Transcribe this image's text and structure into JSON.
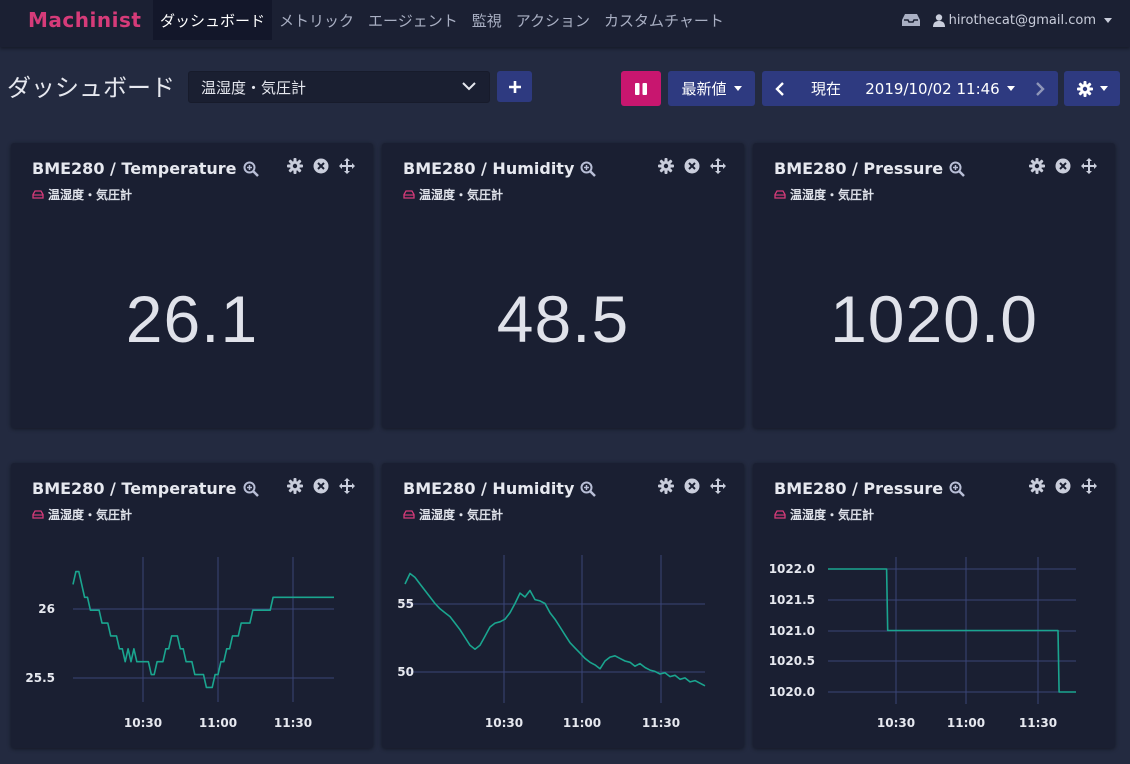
{
  "nav": {
    "brand": "Machinist",
    "items": [
      {
        "label": "ダッシュボード",
        "active": true
      },
      {
        "label": "メトリック"
      },
      {
        "label": "エージェント"
      },
      {
        "label": "監視"
      },
      {
        "label": "アクション"
      },
      {
        "label": "カスタムチャート"
      }
    ],
    "user_email": "hirothecat@gmail.com"
  },
  "toolbar": {
    "title": "ダッシュボード",
    "dashboard_select": "温湿度・気圧計",
    "latest_label": "最新値",
    "now_label": "現在",
    "datetime": "2019/10/02 11:46"
  },
  "colors": {
    "accent": "#c8166f",
    "brand": "#d63b79",
    "button": "#2e3a80",
    "line": "#1aa58f"
  },
  "value_cards": [
    {
      "title": "BME280 / Temperature",
      "agent": "温湿度・気圧計",
      "value": "26.1"
    },
    {
      "title": "BME280 / Humidity",
      "agent": "温湿度・気圧計",
      "value": "48.5"
    },
    {
      "title": "BME280 / Pressure",
      "agent": "温湿度・気圧計",
      "value": "1020.0"
    }
  ],
  "chart_data": [
    {
      "type": "line",
      "title": "BME280 / Temperature",
      "x_ticks": [
        "10:30",
        "11:00",
        "11:30"
      ],
      "y_ticks": [
        "26",
        "25.5"
      ],
      "ylim": [
        25.38,
        26.32
      ],
      "x": [
        0,
        1,
        2,
        3,
        4,
        5,
        6,
        7,
        8,
        9,
        10,
        11,
        12,
        13,
        14,
        15,
        16,
        17,
        18,
        19,
        20,
        21,
        22,
        23,
        24,
        25,
        26,
        27,
        28,
        29,
        30,
        31,
        32,
        33,
        34,
        35,
        36,
        37,
        38,
        39,
        40,
        41,
        42,
        43,
        44,
        45,
        46,
        47,
        48,
        49,
        50,
        51,
        52,
        53,
        54,
        55,
        56,
        57,
        58,
        59,
        60,
        61,
        62,
        63,
        64,
        65,
        66,
        67,
        68,
        69,
        70,
        71,
        72,
        73,
        74,
        75,
        76,
        77,
        78,
        79,
        80,
        81,
        82,
        83,
        84,
        85,
        86,
        87,
        88,
        89,
        90
      ],
      "values": [
        26.2,
        26.3,
        26.3,
        26.2,
        26.1,
        26.1,
        26.0,
        26.0,
        26.0,
        26.0,
        25.9,
        25.9,
        25.9,
        25.8,
        25.8,
        25.8,
        25.7,
        25.7,
        25.6,
        25.7,
        25.6,
        25.7,
        25.6,
        25.6,
        25.6,
        25.6,
        25.6,
        25.5,
        25.5,
        25.6,
        25.6,
        25.6,
        25.7,
        25.7,
        25.8,
        25.8,
        25.8,
        25.7,
        25.7,
        25.6,
        25.6,
        25.6,
        25.5,
        25.5,
        25.5,
        25.5,
        25.4,
        25.4,
        25.4,
        25.5,
        25.5,
        25.6,
        25.6,
        25.7,
        25.7,
        25.8,
        25.8,
        25.8,
        25.9,
        25.9,
        25.9,
        25.9,
        26.0,
        26.0,
        26.0,
        26.0,
        26.0,
        26.0,
        26.0,
        26.1,
        26.1,
        26.1,
        26.1,
        26.1,
        26.1,
        26.1,
        26.1,
        26.1,
        26.1,
        26.1,
        26.1,
        26.1,
        26.1,
        26.1,
        26.1,
        26.1,
        26.1,
        26.1,
        26.1,
        26.1,
        26.1
      ]
    },
    {
      "type": "line",
      "title": "BME280 / Humidity",
      "x_ticks": [
        "10:30",
        "11:00",
        "11:30"
      ],
      "y_ticks": [
        "55",
        "50"
      ],
      "ylim": [
        48.3,
        57.8
      ],
      "x": [
        0,
        1,
        2,
        3,
        4,
        5,
        6,
        7,
        8,
        9,
        10,
        11,
        12,
        13,
        14,
        15,
        16,
        17,
        18,
        19,
        20,
        21,
        22,
        23,
        24,
        25,
        26,
        27,
        28,
        29,
        30,
        31,
        32,
        33,
        34,
        35,
        36,
        37,
        38,
        39,
        40,
        41,
        42,
        43,
        44,
        45,
        46,
        47,
        48,
        49,
        50,
        51,
        52,
        53,
        54,
        55,
        56,
        57,
        58,
        59,
        60
      ],
      "values": [
        56.5,
        57.3,
        57.0,
        56.5,
        56.0,
        55.5,
        55.0,
        54.6,
        54.3,
        54.0,
        53.5,
        53.0,
        52.4,
        51.8,
        51.5,
        51.8,
        52.5,
        53.2,
        53.5,
        53.6,
        53.8,
        54.3,
        55.0,
        55.8,
        55.5,
        56.0,
        55.3,
        55.2,
        55.0,
        54.3,
        53.8,
        53.2,
        52.6,
        52.0,
        51.6,
        51.2,
        50.8,
        50.5,
        50.3,
        50.0,
        50.6,
        50.9,
        51.0,
        50.8,
        50.6,
        50.5,
        50.2,
        50.4,
        50.1,
        49.9,
        49.8,
        49.6,
        49.7,
        49.4,
        49.5,
        49.2,
        49.3,
        49.0,
        49.1,
        48.9,
        48.7
      ]
    },
    {
      "type": "line",
      "title": "BME280 / Pressure",
      "x_ticks": [
        "10:30",
        "11:00",
        "11:30"
      ],
      "y_ticks": [
        "1022.0",
        "1021.5",
        "1021.0",
        "1020.5",
        "1020.0"
      ],
      "ylim": [
        1020.0,
        1022.0
      ],
      "x": [
        0,
        52,
        53,
        204,
        205,
        220
      ],
      "values": [
        1022.0,
        1022.0,
        1021.0,
        1021.0,
        1020.0,
        1020.0
      ]
    }
  ]
}
